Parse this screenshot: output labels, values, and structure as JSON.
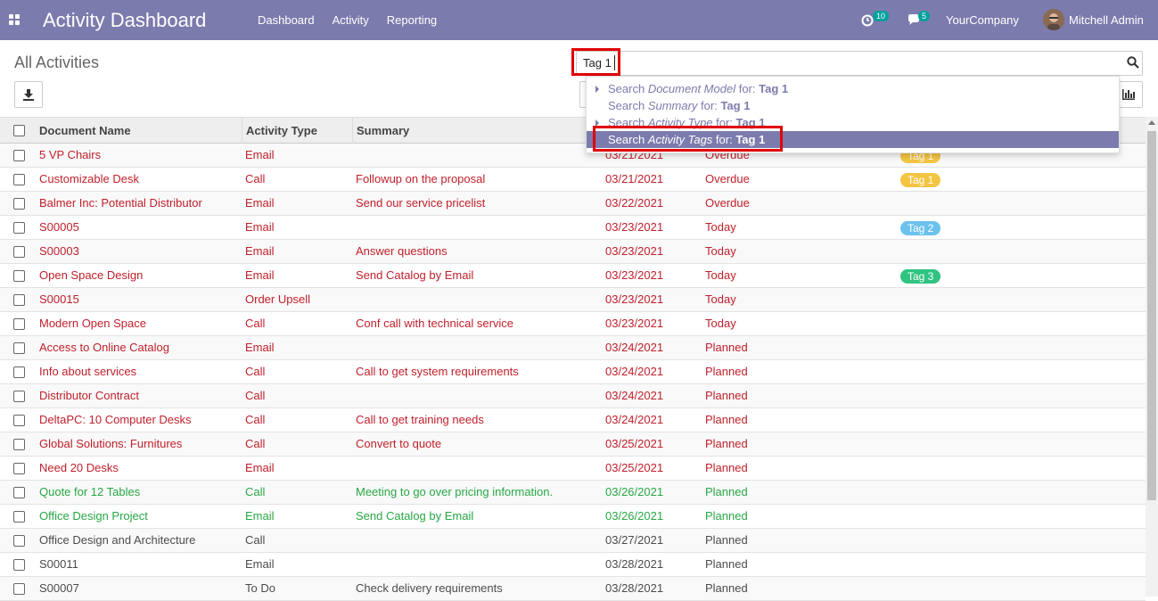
{
  "navbar": {
    "brand": "Activity Dashboard",
    "menu": [
      "Dashboard",
      "Activity",
      "Reporting"
    ],
    "activity_count": "10",
    "message_count": "5",
    "company": "YourCompany",
    "user": "Mitchell Admin",
    "color": "#7c7bad"
  },
  "control": {
    "title": "All Activities",
    "search_value": "Tag 1",
    "icons": [
      "download-icon",
      "search-icon",
      "bar-chart-icon"
    ]
  },
  "dropdown": {
    "items": [
      {
        "prefix": "Search ",
        "field": "Document Model",
        "mid": " for: ",
        "value": "Tag 1",
        "expandable": true,
        "active": false
      },
      {
        "prefix": "Search ",
        "field": "Summary",
        "mid": " for: ",
        "value": "Tag 1",
        "expandable": false,
        "active": false
      },
      {
        "prefix": "Search ",
        "field": "Activity Type",
        "mid": " for: ",
        "value": "Tag 1",
        "expandable": true,
        "active": false
      },
      {
        "prefix": "Search ",
        "field": "Activity Tags",
        "mid": " for: ",
        "value": "Tag 1",
        "expandable": false,
        "active": true
      }
    ]
  },
  "table": {
    "headers": [
      "Document Name",
      "Activity Type",
      "Summary"
    ],
    "rows": [
      {
        "name": "5 VP Chairs",
        "type": "Email",
        "summary": "",
        "date": "03/21/2021",
        "state": "Overdue",
        "tag": "Tag 1",
        "tag_color": "#f4c542",
        "tone": "red"
      },
      {
        "name": "Customizable Desk",
        "type": "Call",
        "summary": "Followup on the proposal",
        "date": "03/21/2021",
        "state": "Overdue",
        "tag": "Tag 1",
        "tag_color": "#f4c542",
        "tone": "red"
      },
      {
        "name": "Balmer Inc: Potential Distributor",
        "type": "Email",
        "summary": "Send our service pricelist",
        "date": "03/22/2021",
        "state": "Overdue",
        "tag": "",
        "tag_color": "",
        "tone": "red"
      },
      {
        "name": "S00005",
        "type": "Email",
        "summary": "",
        "date": "03/23/2021",
        "state": "Today",
        "tag": "Tag 2",
        "tag_color": "#6cc1ed",
        "tone": "red"
      },
      {
        "name": "S00003",
        "type": "Email",
        "summary": "Answer questions",
        "date": "03/23/2021",
        "state": "Today",
        "tag": "",
        "tag_color": "",
        "tone": "red"
      },
      {
        "name": "Open Space Design",
        "type": "Email",
        "summary": "Send Catalog by Email",
        "date": "03/23/2021",
        "state": "Today",
        "tag": "Tag 3",
        "tag_color": "#30c381",
        "tone": "red"
      },
      {
        "name": "S00015",
        "type": "Order Upsell",
        "summary": "",
        "date": "03/23/2021",
        "state": "Today",
        "tag": "",
        "tag_color": "",
        "tone": "red"
      },
      {
        "name": "Modern Open Space",
        "type": "Call",
        "summary": "Conf call with technical service",
        "date": "03/23/2021",
        "state": "Today",
        "tag": "",
        "tag_color": "",
        "tone": "red"
      },
      {
        "name": "Access to Online Catalog",
        "type": "Email",
        "summary": "",
        "date": "03/24/2021",
        "state": "Planned",
        "tag": "",
        "tag_color": "",
        "tone": "red"
      },
      {
        "name": "Info about services",
        "type": "Call",
        "summary": "Call to get system requirements",
        "date": "03/24/2021",
        "state": "Planned",
        "tag": "",
        "tag_color": "",
        "tone": "red"
      },
      {
        "name": "Distributor Contract",
        "type": "Call",
        "summary": "",
        "date": "03/24/2021",
        "state": "Planned",
        "tag": "",
        "tag_color": "",
        "tone": "red"
      },
      {
        "name": "DeltaPC: 10 Computer Desks",
        "type": "Call",
        "summary": "Call to get training needs",
        "date": "03/24/2021",
        "state": "Planned",
        "tag": "",
        "tag_color": "",
        "tone": "red"
      },
      {
        "name": "Global Solutions: Furnitures",
        "type": "Call",
        "summary": "Convert to quote",
        "date": "03/25/2021",
        "state": "Planned",
        "tag": "",
        "tag_color": "",
        "tone": "red"
      },
      {
        "name": "Need 20 Desks",
        "type": "Email",
        "summary": "",
        "date": "03/25/2021",
        "state": "Planned",
        "tag": "",
        "tag_color": "",
        "tone": "red"
      },
      {
        "name": "Quote for 12 Tables",
        "type": "Call",
        "summary": "Meeting to go over pricing information.",
        "date": "03/26/2021",
        "state": "Planned",
        "tag": "",
        "tag_color": "",
        "tone": "green"
      },
      {
        "name": "Office Design Project",
        "type": "Email",
        "summary": "Send Catalog by Email",
        "date": "03/26/2021",
        "state": "Planned",
        "tag": "",
        "tag_color": "",
        "tone": "green"
      },
      {
        "name": "Office Design and Architecture",
        "type": "Call",
        "summary": "",
        "date": "03/27/2021",
        "state": "Planned",
        "tag": "",
        "tag_color": "",
        "tone": "dark"
      },
      {
        "name": "S00011",
        "type": "Email",
        "summary": "",
        "date": "03/28/2021",
        "state": "Planned",
        "tag": "",
        "tag_color": "",
        "tone": "dark"
      },
      {
        "name": "S00007",
        "type": "To Do",
        "summary": "Check delivery requirements",
        "date": "03/28/2021",
        "state": "Planned",
        "tag": "",
        "tag_color": "",
        "tone": "dark"
      }
    ]
  }
}
